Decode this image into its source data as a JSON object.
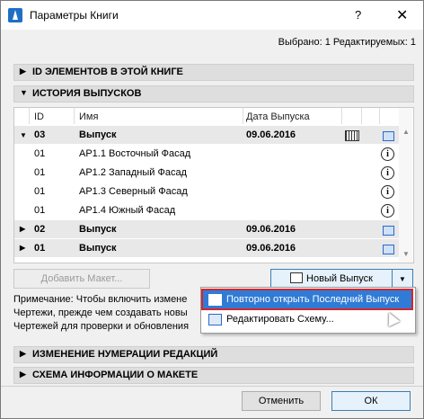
{
  "window": {
    "title": "Параметры Книги",
    "help": "?",
    "close": "✕"
  },
  "selection_info": "Выбрано: 1 Редактируемых: 1",
  "sections": {
    "ids": "ID ЭЛЕМЕНТОВ В ЭТОЙ КНИГЕ",
    "history": "ИСТОРИЯ ВЫПУСКОВ",
    "renumber": "ИЗМЕНЕНИЕ НУМЕРАЦИИ РЕДАКЦИЙ",
    "scheme": "СХЕМА ИНФОРМАЦИИ О МАКЕТЕ"
  },
  "table": {
    "headers": {
      "id": "ID",
      "name": "Имя",
      "date": "Дата Выпуска"
    },
    "rows": [
      {
        "id": "03",
        "name": "Выпуск",
        "date": "09.06.2016",
        "kind": "release",
        "expanded": true
      },
      {
        "id": "01",
        "name": "AP1.1 Восточный Фасад",
        "date": "",
        "kind": "layout"
      },
      {
        "id": "01",
        "name": "AP1.2 Западный Фасад",
        "date": "",
        "kind": "layout"
      },
      {
        "id": "01",
        "name": "AP1.3 Северный Фасад",
        "date": "",
        "kind": "layout"
      },
      {
        "id": "01",
        "name": "AP1.4 Южный Фасад",
        "date": "",
        "kind": "layout"
      },
      {
        "id": "02",
        "name": "Выпуск",
        "date": "09.06.2016",
        "kind": "release",
        "expanded": false
      },
      {
        "id": "01",
        "name": "Выпуск",
        "date": "09.06.2016",
        "kind": "release",
        "expanded": false
      }
    ]
  },
  "buttons": {
    "add_layout": "Добавить Макет...",
    "new_release": "Новый Выпуск",
    "cancel": "Отменить",
    "ok": "ОК"
  },
  "note": {
    "line1": "Примечание: Чтобы включить измене",
    "line2": "Чертежи, прежде чем создавать новы",
    "line3": "Чертежей для проверки и обновления"
  },
  "menu": {
    "reopen": "Повторно открыть Последний Выпуск",
    "edit_scheme": "Редактировать Схему..."
  }
}
